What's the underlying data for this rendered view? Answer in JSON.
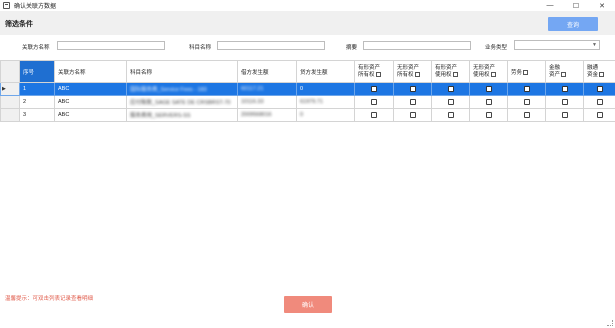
{
  "window": {
    "title": "确认关联方数据",
    "minimize_glyph": "—",
    "maximize_glyph": "☐",
    "close_glyph": "✕"
  },
  "filter": {
    "title": "筛选条件",
    "query_label": "查询",
    "related_name_label": "关联方名称",
    "related_name_value": "",
    "subject_name_label": "科目名称",
    "subject_name_value": "",
    "summary_label": "摘要",
    "summary_value": "",
    "business_type_label": "业务类型",
    "business_type_value": ""
  },
  "grid": {
    "columns": {
      "seq": "序号",
      "related_name": "关联方名称",
      "subject_name": "科目名称",
      "debit": "借方发生额",
      "credit": "贷方发生额",
      "tangible_ownership": [
        "有形资产",
        "所有权"
      ],
      "intangible_ownership": [
        "无形资产",
        "所有权"
      ],
      "tangible_usage": [
        "有形资产",
        "使用权"
      ],
      "intangible_usage": [
        "无形资产",
        "使用权"
      ],
      "labor": "劳务",
      "financial_asset": [
        "金融",
        "资产"
      ],
      "financing": [
        "融通",
        "资金"
      ]
    },
    "rows": [
      {
        "seq": "1",
        "related_name": "ABC",
        "subject_name": "国际服务费_Service Fees - 183",
        "debit": "60117.21",
        "credit": "0",
        "selected": true
      },
      {
        "seq": "2",
        "related_name": "ABC",
        "subject_name": "应付账款_SAGE SATE DE CRSBRST-70",
        "debit": "10116.33",
        "credit": "61979.71",
        "selected": false
      },
      {
        "seq": "3",
        "related_name": "ABC",
        "subject_name": "服务费用_SERVERS-SS",
        "debit": "2009568016",
        "credit": "0",
        "selected": false
      }
    ]
  },
  "footer": {
    "hint": "温馨提示：可双击列表记录查看明细",
    "confirm_label": "确认"
  },
  "colors": {
    "selected_row": "#1d76e3",
    "query_button": "#74a7f3",
    "confirm_button": "#f08a7c",
    "hint_text": "#e05a4a"
  }
}
